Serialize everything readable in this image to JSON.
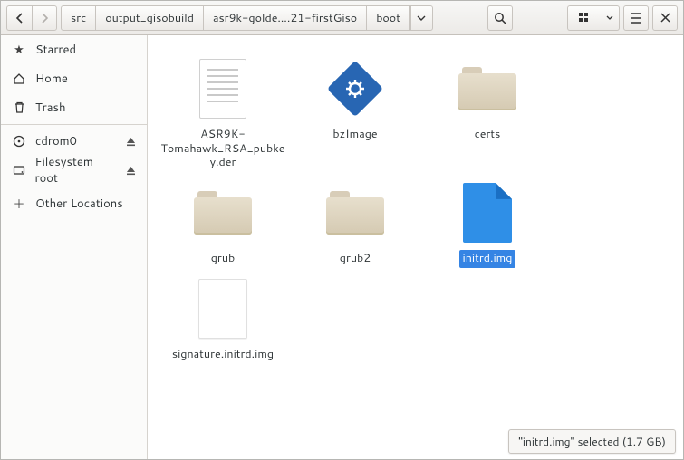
{
  "breadcrumb": {
    "items": [
      "src",
      "output_gisobuild",
      "asr9k-golde….21-firstGiso",
      "boot"
    ]
  },
  "sidebar": {
    "starred": "Starred",
    "home": "Home",
    "trash": "Trash",
    "cdrom": "cdrom0",
    "fsroot": "Filesystem root",
    "other": "Other Locations"
  },
  "files": [
    {
      "name": "ASR9K-Tomahawk_RSA_pubkey.der",
      "kind": "text",
      "selected": false
    },
    {
      "name": "bzImage",
      "kind": "gear",
      "selected": false
    },
    {
      "name": "certs",
      "kind": "folder",
      "selected": false
    },
    {
      "name": "grub",
      "kind": "folder",
      "selected": false
    },
    {
      "name": "grub2",
      "kind": "folder",
      "selected": false
    },
    {
      "name": "initrd.img",
      "kind": "blue",
      "selected": true
    },
    {
      "name": "signature.initrd.img",
      "kind": "plain",
      "selected": false
    }
  ],
  "status": "\"initrd.img\" selected (1.7 GB)"
}
